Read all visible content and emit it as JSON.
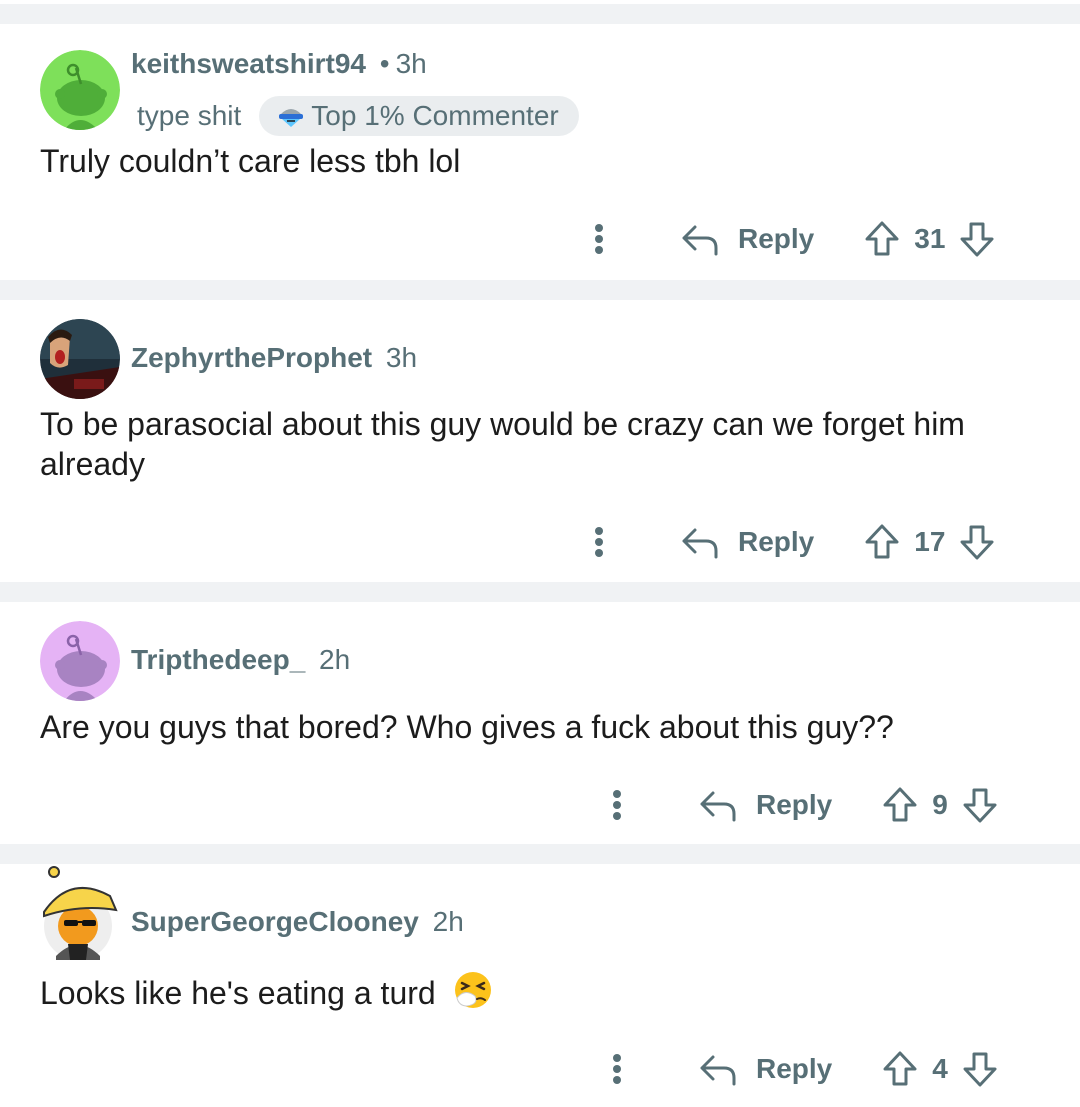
{
  "comments": [
    {
      "username": "keithsweatshirt94",
      "separator": "•",
      "time": "3h",
      "flair_text": "type shit",
      "badge": "Top 1% Commenter",
      "body": "Truly couldn’t care less tbh lol",
      "reply_label": "Reply",
      "votes": "31",
      "avatar": "green-snoo-avatar"
    },
    {
      "username": "ZephyrtheProphet",
      "time": "3h",
      "body": "To be parasocial about this guy would be crazy can we forget him already",
      "reply_label": "Reply",
      "votes": "17",
      "avatar": "cartoon-photo-avatar"
    },
    {
      "username": "Tripthedeep_",
      "time": "2h",
      "body": "Are you guys that bored? Who gives a fuck about this guy??",
      "reply_label": "Reply",
      "votes": "9",
      "avatar": "purple-snoo-avatar"
    },
    {
      "username": "SuperGeorgeClooney",
      "time": "2h",
      "body": "Looks like he's eating a turd",
      "body_emoji": "sneezing-face-emoji",
      "reply_label": "Reply",
      "votes": "4",
      "avatar": "orange-hat-snoo-avatar"
    }
  ],
  "colors": {
    "meta_text": "#576f76",
    "body_text": "#1c1c1c",
    "separator": "#f0f2f4",
    "badge_bg": "#eaedef"
  }
}
